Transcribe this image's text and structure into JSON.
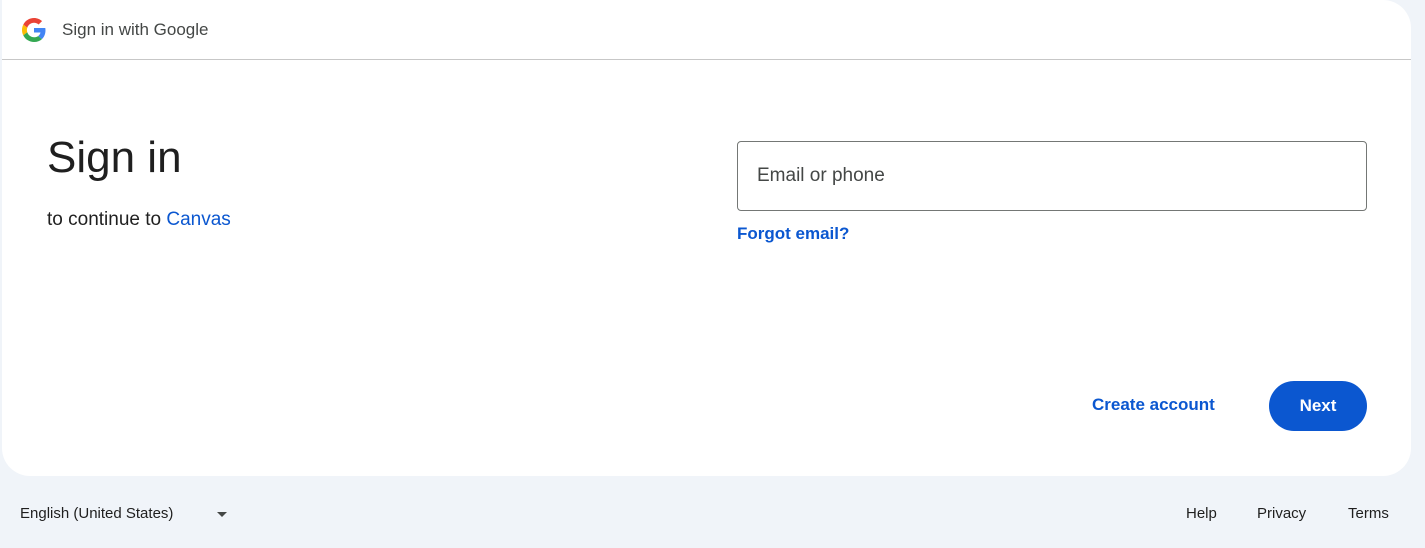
{
  "header": {
    "title": "Sign in with Google",
    "logo_icon": "google-g-icon"
  },
  "main": {
    "heading": "Sign in",
    "subheading_prefix": "to continue to ",
    "app_name": "Canvas"
  },
  "form": {
    "email_placeholder": "Email or phone",
    "email_value": "",
    "forgot_email_label": "Forgot email?"
  },
  "actions": {
    "create_account_label": "Create account",
    "next_label": "Next"
  },
  "footer": {
    "language": "English (United States)",
    "language_dropdown_icon": "caret-down-icon",
    "links": [
      "Help",
      "Privacy",
      "Terms"
    ]
  },
  "colors": {
    "accent": "#0b57d0",
    "background": "#f0f4f9",
    "card": "#ffffff",
    "text": "#1f1f1f"
  }
}
